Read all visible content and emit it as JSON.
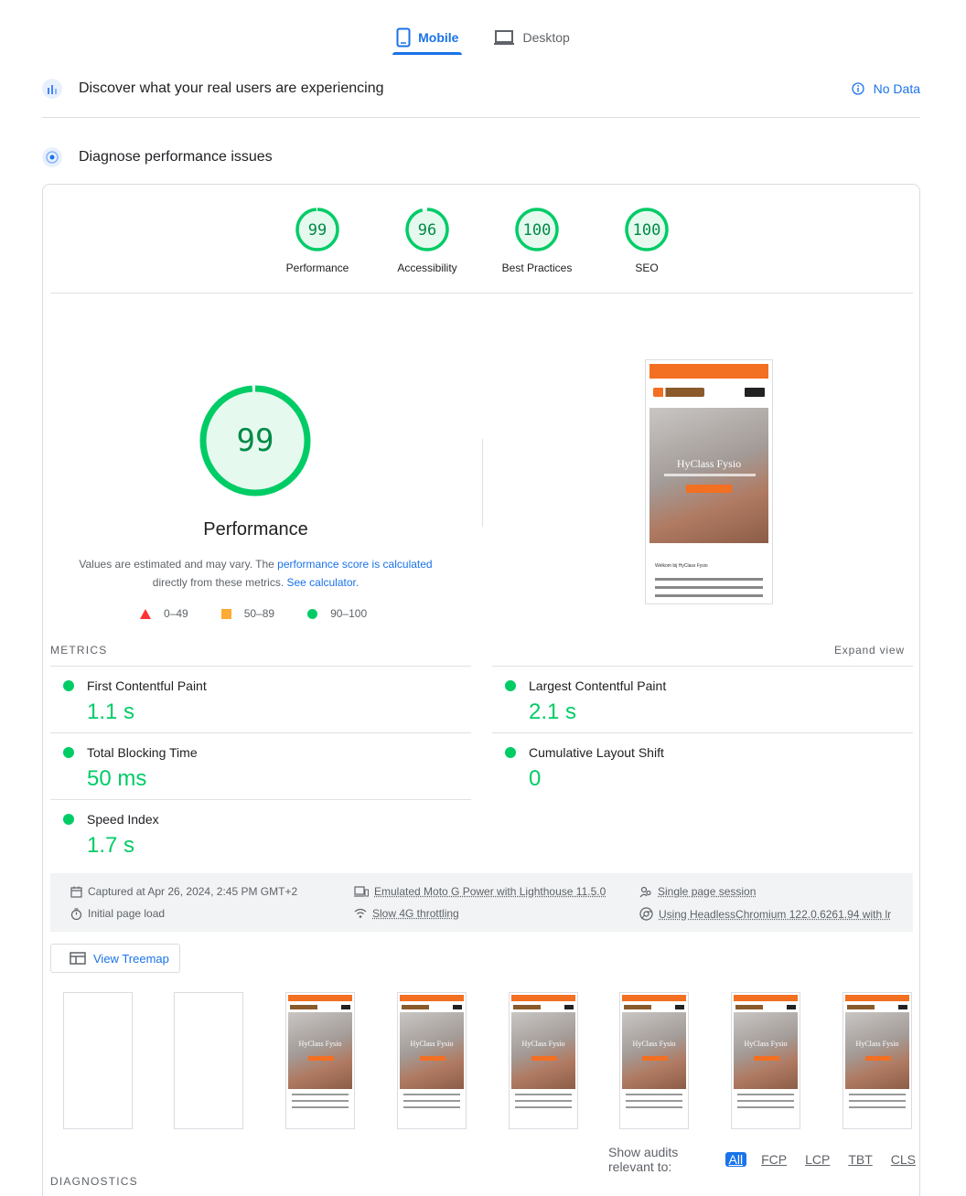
{
  "tabs": [
    {
      "label": "Mobile",
      "active": true
    },
    {
      "label": "Desktop",
      "active": false
    }
  ],
  "field_section": {
    "title": "Discover what your real users are experiencing",
    "status": "No Data"
  },
  "lab_section": {
    "title": "Diagnose performance issues"
  },
  "categories": [
    {
      "label": "Performance",
      "score": "99"
    },
    {
      "label": "Accessibility",
      "score": "96"
    },
    {
      "label": "Best Practices",
      "score": "100"
    },
    {
      "label": "SEO",
      "score": "100"
    }
  ],
  "performance": {
    "score": "99",
    "title": "Performance",
    "desc_prefix": "Values are estimated and may vary. The ",
    "desc_link1": "performance score is calculated",
    "desc_middle": " directly from these metrics. ",
    "desc_link2": "See calculator.",
    "legend": [
      {
        "range": "0–49",
        "color": "#ff3333"
      },
      {
        "range": "50–89",
        "color": "#ffaa33"
      },
      {
        "range": "90–100",
        "color": "#00cc66"
      }
    ]
  },
  "screenshot": {
    "hero_title": "HyClass Fysio",
    "welcome": "Welkom bij HyClass Fysio"
  },
  "metrics_header": {
    "label": "METRICS",
    "expand": "Expand view"
  },
  "metrics": [
    {
      "name": "First Contentful Paint",
      "value": "1.1 s"
    },
    {
      "name": "Largest Contentful Paint",
      "value": "2.1 s"
    },
    {
      "name": "Total Blocking Time",
      "value": "50 ms"
    },
    {
      "name": "Cumulative Layout Shift",
      "value": "0"
    },
    {
      "name": "Speed Index",
      "value": "1.7 s"
    }
  ],
  "runtime": {
    "captured": "Captured at Apr 26, 2024, 2:45 PM GMT+2",
    "initial_load": "Initial page load",
    "device": "Emulated Moto G Power with Lighthouse 11.5.0",
    "throttling": "Slow 4G throttling",
    "session": "Single page session",
    "browser": "Using HeadlessChromium 122.0.6261.94 with lr"
  },
  "treemap_label": "View Treemap",
  "audits_filter": {
    "label": "Show audits relevant to:",
    "options": [
      "All",
      "FCP",
      "LCP",
      "TBT",
      "CLS"
    ],
    "selected": "All"
  },
  "diagnostics_label": "DIAGNOSTICS",
  "colors": {
    "pass": "#00cc66",
    "accent": "#1a73e8",
    "brand_orange": "#f36f21"
  }
}
